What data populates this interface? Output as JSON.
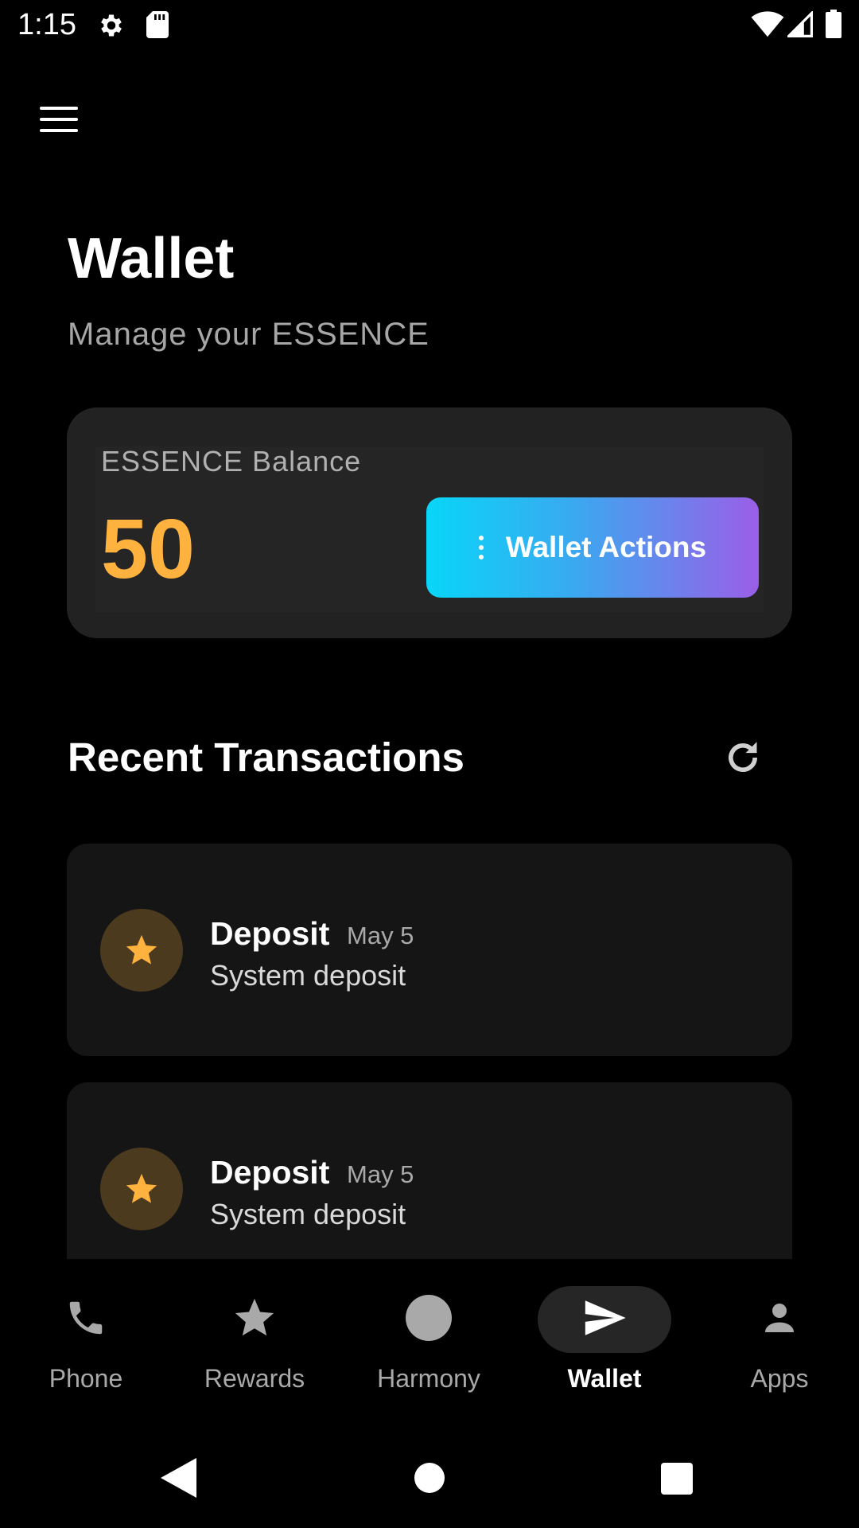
{
  "status_bar": {
    "time": "1:15"
  },
  "header": {
    "title": "Wallet",
    "subtitle": "Manage your ESSENCE"
  },
  "balance": {
    "label": "ESSENCE Balance",
    "value": "50",
    "actions_label": "Wallet Actions"
  },
  "transactions": {
    "title": "Recent Transactions",
    "items": [
      {
        "title": "Deposit",
        "date": "May 5",
        "description": "System deposit",
        "icon": "star-icon"
      },
      {
        "title": "Deposit",
        "date": "May 5",
        "description": "System deposit",
        "icon": "star-icon"
      }
    ]
  },
  "bottom_nav": {
    "items": [
      {
        "label": "Phone",
        "icon": "phone-icon"
      },
      {
        "label": "Rewards",
        "icon": "star-icon"
      },
      {
        "label": "Harmony",
        "icon": "circle-icon"
      },
      {
        "label": "Wallet",
        "icon": "send-icon",
        "active": true
      },
      {
        "label": "Apps",
        "icon": "person-icon"
      }
    ]
  },
  "colors": {
    "accent": "#ffb23e",
    "gradient_start": "#08d6f8",
    "gradient_end": "#9b5ee8",
    "card": "#222222"
  }
}
